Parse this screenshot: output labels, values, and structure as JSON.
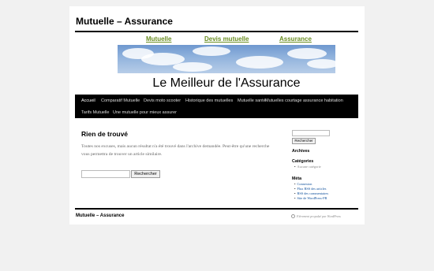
{
  "site": {
    "title": "Mutuelle – Assurance"
  },
  "top_links": [
    "Mutuelle",
    "Devis mutuelle",
    "Assurance"
  ],
  "banner": {
    "text": "Le Meilleur de l'Assurance"
  },
  "nav": {
    "items": [
      "Accueil",
      "Comparatif Mutuelle",
      "Devis moto scooter",
      "Historique des mutuelles",
      "Mutuelle santé",
      "Mutuelles courtage assurance habitation",
      "Tarifs Mutuelle",
      "Une mutuelle pour mieux assurer"
    ]
  },
  "content": {
    "heading": "Rien de trouvé",
    "body": "Toutes nos excuses, mais aucun résultat n'a été trouvé dans l'archive demandée. Peut-être qu'une recherche vous permettra de trouver un article similaire.",
    "search_button": "Rechercher"
  },
  "sidebar": {
    "search_button": "Rechercher",
    "archives_heading": "Archives",
    "categories_heading": "Catégories",
    "categories_items": [
      "Aucune catégorie"
    ],
    "meta_heading": "Méta",
    "meta_items": [
      "Connexion",
      "Flux RSS des articles",
      "RSS des commentaires",
      "Site de WordPress-FR"
    ]
  },
  "footer": {
    "title": "Mutuelle – Assurance",
    "credit": "Fièrement propulsé par WordPress"
  },
  "colors": {
    "link_green": "#6b8e23",
    "nav_bg": "#000000",
    "banner_underline": "#d62020"
  },
  "icons": [
    "wordpress-icon"
  ]
}
